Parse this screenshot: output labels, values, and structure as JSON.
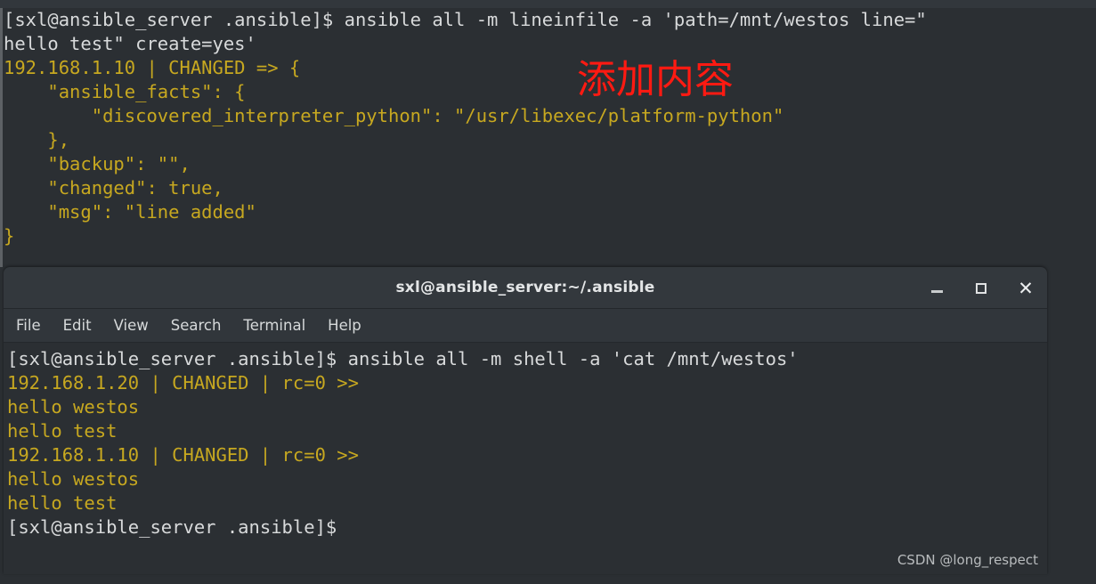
{
  "background_terminal": {
    "name": "background-terminal-output",
    "lines": [
      {
        "text": "[sxl@ansible_server .ansible]$ ansible all -m lineinfile -a 'path=/mnt/westos line=\"",
        "color": "white"
      },
      {
        "text": "hello test\" create=yes'",
        "color": "white"
      },
      {
        "text": "192.168.1.10 | CHANGED => {",
        "color": "yellow"
      },
      {
        "text": "    \"ansible_facts\": {",
        "color": "yellow"
      },
      {
        "text": "        \"discovered_interpreter_python\": \"/usr/libexec/platform-python\"",
        "color": "yellow"
      },
      {
        "text": "    },",
        "color": "yellow"
      },
      {
        "text": "    \"backup\": \"\",",
        "color": "yellow"
      },
      {
        "text": "    \"changed\": true,",
        "color": "yellow"
      },
      {
        "text": "    \"msg\": \"line added\"",
        "color": "yellow"
      },
      {
        "text": "}",
        "color": "yellow"
      }
    ]
  },
  "annotation": {
    "text": "添加内容",
    "color": "#ff1a12"
  },
  "window": {
    "title": "sxl@ansible_server:~/.ansible",
    "controls": {
      "minimize_label": "",
      "maximize_label": "",
      "close_label": "✕"
    },
    "menu": [
      {
        "label": "File"
      },
      {
        "label": "Edit"
      },
      {
        "label": "View"
      },
      {
        "label": "Search"
      },
      {
        "label": "Terminal"
      },
      {
        "label": "Help"
      }
    ],
    "terminal": {
      "lines": [
        {
          "text": "[sxl@ansible_server .ansible]$ ansible all -m shell -a 'cat /mnt/westos'",
          "color": "white"
        },
        {
          "text": "192.168.1.20 | CHANGED | rc=0 >>",
          "color": "yellow"
        },
        {
          "text": "hello westos",
          "color": "yellow"
        },
        {
          "text": "hello test",
          "color": "yellow"
        },
        {
          "text": "192.168.1.10 | CHANGED | rc=0 >>",
          "color": "yellow"
        },
        {
          "text": "hello westos",
          "color": "yellow"
        },
        {
          "text": "hello test",
          "color": "yellow"
        },
        {
          "text": "[sxl@ansible_server .ansible]$",
          "color": "white"
        }
      ]
    }
  },
  "watermark": {
    "text": "CSDN @long_respect"
  },
  "colors": {
    "terminal_background": "#2b2f33",
    "titlebar_background": "#33383d",
    "menubar_background": "#31363b",
    "text_white": "#d8dadb",
    "text_yellow": "#c7a820",
    "annotation_red": "#ff1a12"
  }
}
